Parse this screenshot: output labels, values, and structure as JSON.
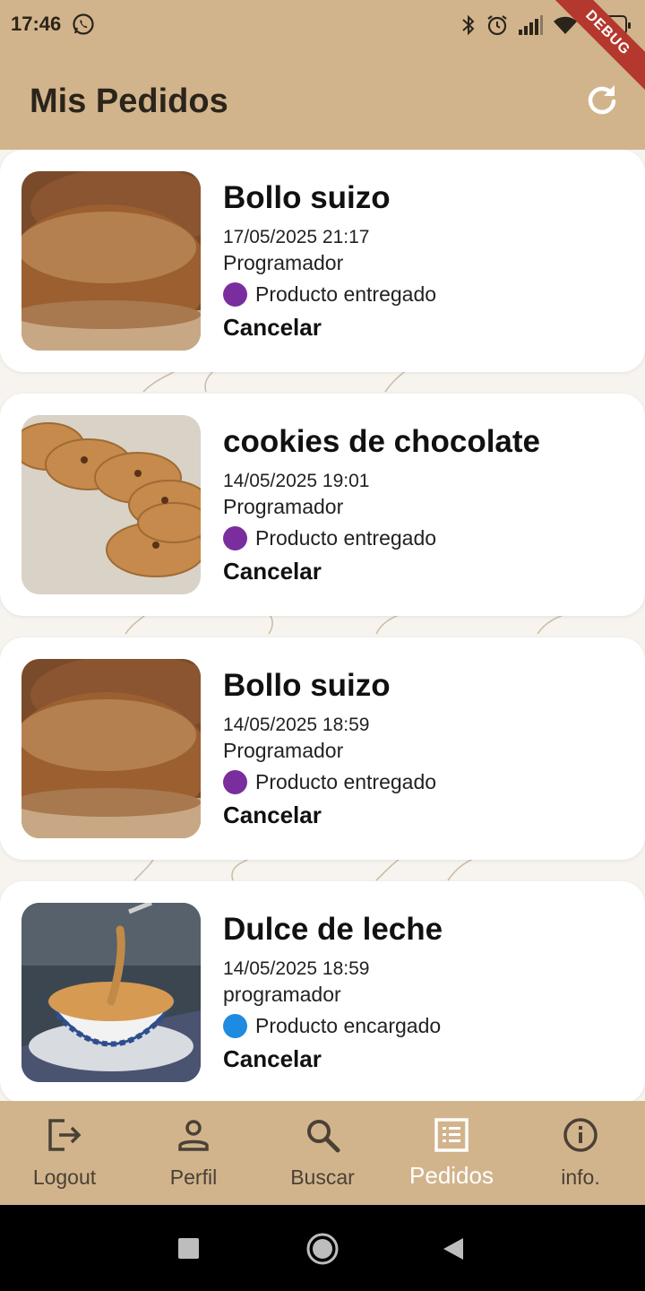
{
  "status_bar": {
    "time": "17:46",
    "battery": "35",
    "debug_banner": "DEBUG"
  },
  "app_bar": {
    "title": "Mis Pedidos",
    "refresh_icon": "refresh-icon"
  },
  "orders": [
    {
      "product": "Bollo suizo",
      "datetime": "17/05/2025 21:17",
      "user": "Programador",
      "status_emoji": "🟣",
      "status_text": "Producto entregado",
      "status_color": "#7a2e9e",
      "action": "Cancelar",
      "image": "bread"
    },
    {
      "product": "cookies de chocolate",
      "datetime": "14/05/2025 19:01",
      "user": "Programador",
      "status_emoji": "🟣",
      "status_text": "Producto entregado",
      "status_color": "#7a2e9e",
      "action": "Cancelar",
      "image": "cookies"
    },
    {
      "product": "Bollo suizo",
      "datetime": "14/05/2025 18:59",
      "user": "Programador",
      "status_emoji": "🟣",
      "status_text": "Producto entregado",
      "status_color": "#7a2e9e",
      "action": "Cancelar",
      "image": "bread"
    },
    {
      "product": "Dulce de leche",
      "datetime": "14/05/2025 18:59",
      "user": "programador",
      "status_emoji": "🔵",
      "status_text": "Producto encargado",
      "status_color": "#1e8ae0",
      "action": "Cancelar",
      "image": "dulce"
    }
  ],
  "bottom_nav": {
    "items": [
      {
        "label": "Logout",
        "icon": "logout-icon",
        "active": false
      },
      {
        "label": "Perfil",
        "icon": "person-icon",
        "active": false
      },
      {
        "label": "Buscar",
        "icon": "search-icon",
        "active": false
      },
      {
        "label": "Pedidos",
        "icon": "list-icon",
        "active": true
      },
      {
        "label": "info.",
        "icon": "info-icon",
        "active": false
      }
    ]
  },
  "colors": {
    "app_bar": "#d2b48c",
    "card": "#ffffff",
    "active_nav": "#ffffff",
    "inactive_nav": "#4a4036"
  }
}
